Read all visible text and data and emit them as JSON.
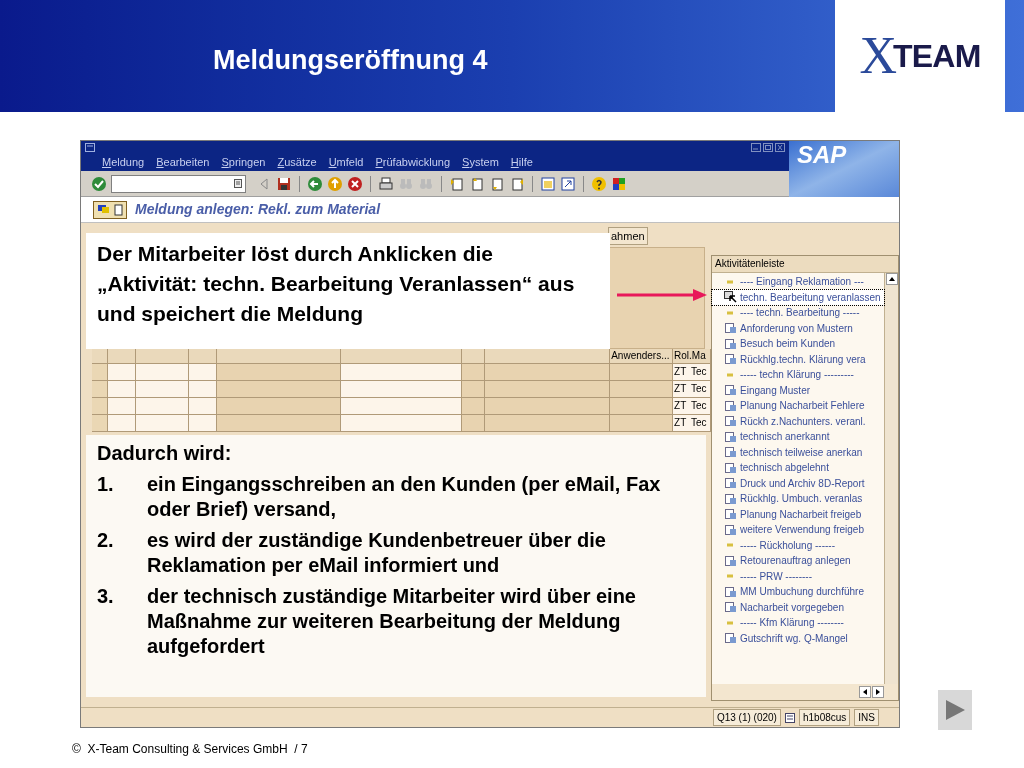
{
  "slide": {
    "title": "Meldungseröffnung 4",
    "logo": {
      "mark": "X",
      "text": "TEAM"
    },
    "footer": "©  X-Team Consulting & Services GmbH  / 7"
  },
  "sap": {
    "menu": [
      "Meldung",
      "Bearbeiten",
      "Springen",
      "Zusätze",
      "Umfeld",
      "Prüfabwicklung",
      "System",
      "Hilfe"
    ],
    "logo": "SAP",
    "screen_title": "Meldung anlegen: Rekl. zum Material",
    "app_toolbar_button": "ahmen",
    "table": {
      "columns": [
        "Anwenders...",
        "Rol.Ma"
      ],
      "rows": [
        {
          "cells": [
            "ZT",
            "Tec"
          ]
        },
        {
          "cells": [
            "ZT",
            "Tec"
          ]
        },
        {
          "cells": [
            "ZT",
            "Tec"
          ]
        },
        {
          "cells": [
            "ZT",
            "Tec"
          ]
        }
      ]
    },
    "activity_bar": {
      "title": "Aktivitätenleiste",
      "items": [
        {
          "kind": "separator",
          "label": "---- Eingang Reklamation ---",
          "selected": false
        },
        {
          "kind": "action",
          "label": "techn. Bearbeitung veranlassen",
          "selected": true
        },
        {
          "kind": "separator",
          "label": "---- techn. Bearbeitung -----",
          "selected": false
        },
        {
          "kind": "action",
          "label": "Anforderung von Mustern",
          "selected": false
        },
        {
          "kind": "action",
          "label": "Besuch beim Kunden",
          "selected": false
        },
        {
          "kind": "action",
          "label": "Rückhlg.techn. Klärung vera",
          "selected": false
        },
        {
          "kind": "separator",
          "label": "----- techn Klärung ---------",
          "selected": false
        },
        {
          "kind": "action",
          "label": "Eingang Muster",
          "selected": false
        },
        {
          "kind": "action",
          "label": "Planung Nacharbeit Fehlere",
          "selected": false
        },
        {
          "kind": "action",
          "label": "Rückh z.Nachunters. veranl.",
          "selected": false
        },
        {
          "kind": "action",
          "label": "technisch anerkannt",
          "selected": false
        },
        {
          "kind": "action",
          "label": "technisch teilweise anerkan",
          "selected": false
        },
        {
          "kind": "action",
          "label": "technisch abgelehnt",
          "selected": false
        },
        {
          "kind": "action",
          "label": "Druck und Archiv 8D-Report",
          "selected": false
        },
        {
          "kind": "action",
          "label": "Rückhlg. Umbuch. veranlas",
          "selected": false
        },
        {
          "kind": "action",
          "label": "Planung Nacharbeit freigeb",
          "selected": false
        },
        {
          "kind": "action",
          "label": "weitere Verwendung freigeb",
          "selected": false
        },
        {
          "kind": "separator",
          "label": "----- Rückholung ------",
          "selected": false
        },
        {
          "kind": "action",
          "label": "Retourenauftrag anlegen",
          "selected": false
        },
        {
          "kind": "separator",
          "label": "----- PRW --------",
          "selected": false
        },
        {
          "kind": "action",
          "label": "MM Umbuchung durchführe",
          "selected": false
        },
        {
          "kind": "action",
          "label": "Nacharbeit vorgegeben",
          "selected": false
        },
        {
          "kind": "separator",
          "label": "----- Kfm Klärung --------",
          "selected": false
        },
        {
          "kind": "action",
          "label": "Gutschrift wg. Q-Mangel",
          "selected": false
        }
      ]
    },
    "status_bar": {
      "system": "Q13 (1) (020)",
      "host": "h1b08cus",
      "mode": "INS"
    }
  },
  "callout": "Der Mitarbeiter löst durch Anklicken die „Aktivität: techn. Bearbeitung Veranlassen“ aus und speichert die Meldung",
  "explanation": {
    "intro": "Dadurch wird:",
    "items": [
      {
        "number": "1.",
        "text": "ein Eingangsschreiben an den Kunden (per eMail, Fax oder Brief) versand,"
      },
      {
        "number": "2.",
        "text": "es wird der zuständige Kundenbetreuer über die Reklamation per eMail informiert und"
      },
      {
        "number": "3.",
        "text": "der technisch zuständige Mitarbeiter wird über eine Maßnahme zur weiteren Bearbeitung der Meldung aufgefordert"
      }
    ]
  }
}
